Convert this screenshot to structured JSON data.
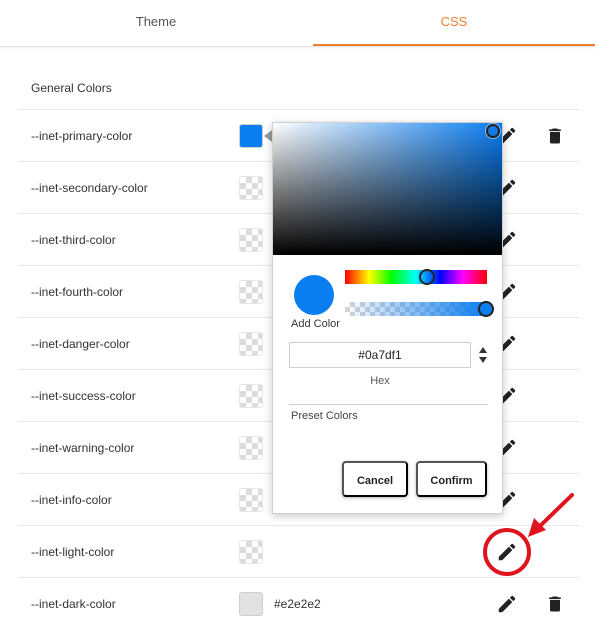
{
  "tabs": [
    {
      "label": "Theme",
      "active": false
    },
    {
      "label": "CSS",
      "active": true
    }
  ],
  "accent_color": "#f07d30",
  "section_title": "General Colors",
  "rows": [
    {
      "label": "--inet-primary-color",
      "swatch": "#0a7df1",
      "value": ""
    },
    {
      "label": "--inet-secondary-color",
      "swatch": "transparent",
      "value": ""
    },
    {
      "label": "--inet-third-color",
      "swatch": "transparent",
      "value": ""
    },
    {
      "label": "--inet-fourth-color",
      "swatch": "transparent",
      "value": ""
    },
    {
      "label": "--inet-danger-color",
      "swatch": "transparent",
      "value": ""
    },
    {
      "label": "--inet-success-color",
      "swatch": "transparent",
      "value": ""
    },
    {
      "label": "--inet-warning-color",
      "swatch": "transparent",
      "value": ""
    },
    {
      "label": "--inet-info-color",
      "swatch": "transparent",
      "value": ""
    },
    {
      "label": "--inet-light-color",
      "swatch": "transparent",
      "value": ""
    },
    {
      "label": "--inet-dark-color",
      "swatch": "#e2e2e2",
      "value": "#e2e2e2"
    }
  ],
  "icons": {
    "edit": "pencil-icon",
    "delete": "trash-icon",
    "spinner": "up-down-arrows-icon"
  },
  "color_picker": {
    "current_color": "#0a7df1",
    "add_color_label": "Add Color",
    "hex_value": "#0a7df1",
    "hex_label": "Hex",
    "preset_label": "Preset Colors",
    "cancel_label": "Cancel",
    "confirm_label": "Confirm"
  },
  "annotation_color": "#e0141e"
}
